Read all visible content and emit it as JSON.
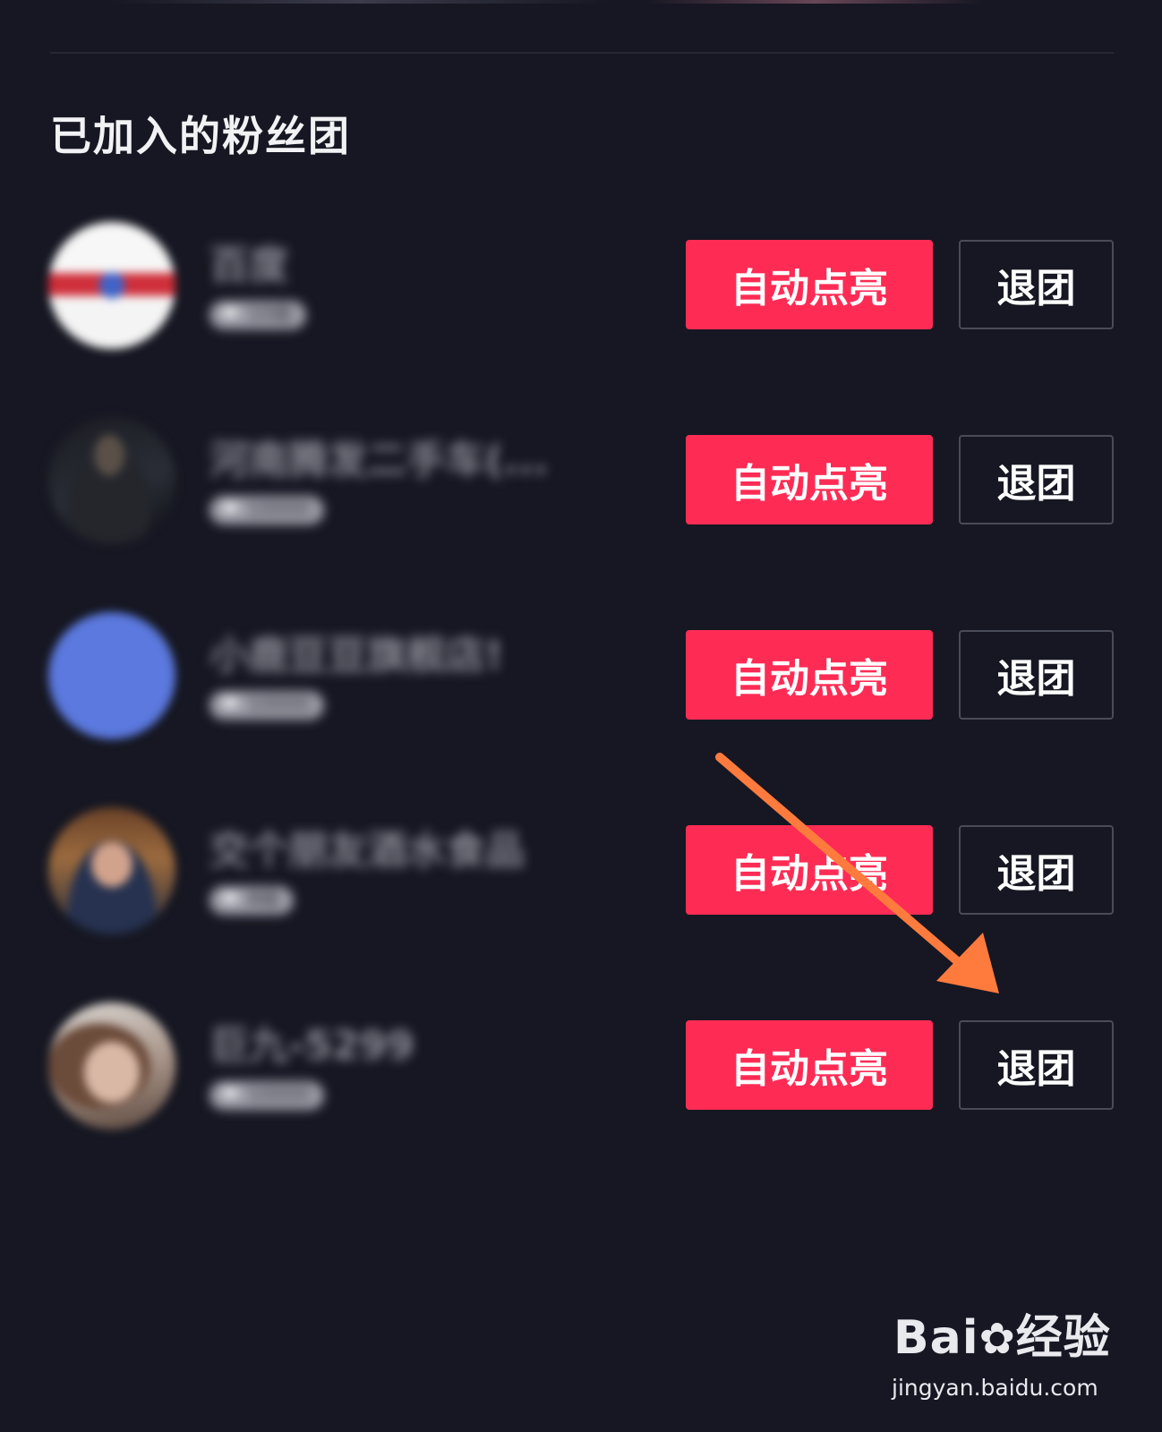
{
  "section": {
    "title": "已加入的粉丝团"
  },
  "fan_clubs": [
    {
      "name": "百度",
      "level": "10级",
      "light_label": "自动点亮",
      "quit_label": "退团"
    },
    {
      "name": "河南腾发二手车(...",
      "level": "10000",
      "light_label": "自动点亮",
      "quit_label": "退团"
    },
    {
      "name": "小鹿豆豆旗舰店!",
      "level": "10000",
      "light_label": "自动点亮",
      "quit_label": "退团"
    },
    {
      "name": "交个朋友酒水食品",
      "level": "8级",
      "light_label": "自动点亮",
      "quit_label": "退团"
    },
    {
      "name": "巨九-5299",
      "level": "10000",
      "light_label": "自动点亮",
      "quit_label": "退团"
    }
  ],
  "annotation": {
    "arrow_color": "#ff7a3d"
  },
  "watermark": {
    "logo_text": "Bai",
    "logo_suffix": "经验",
    "url": "jingyan.baidu.com"
  },
  "colors": {
    "background": "#161722",
    "accent": "#fe2c55",
    "outline": "#4a4b58"
  }
}
